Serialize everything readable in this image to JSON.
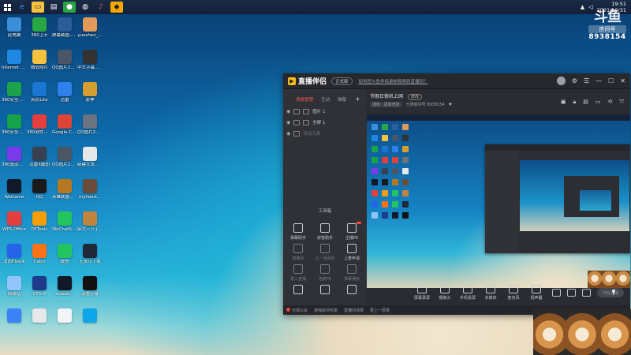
{
  "taskbar": {
    "clock_time": "19:51",
    "clock_date": "2021/10/31",
    "icons": [
      "start-icon",
      "edge-icon",
      "file-explorer-icon",
      "store-icon",
      "qq-icon",
      "app-icon",
      "douyin-icon",
      "obs-icon"
    ]
  },
  "watermark": {
    "logo": "斗鱼",
    "sub": "房间号",
    "room_id": "8938154"
  },
  "desktop_icons": [
    {
      "label": "此电脑",
      "color": "#3a8fd8"
    },
    {
      "label": "360卫士",
      "color": "#28a745"
    },
    {
      "label": "屏幕截图.png",
      "color": "#2b5d9a"
    },
    {
      "label": "yueshen_...",
      "color": "#e09a5a"
    },
    {
      "label": "Internet Explorer",
      "color": "#1e88e5"
    },
    {
      "label": "微软照片",
      "color": "#f6c23e"
    },
    {
      "label": "QQ图片2021072...",
      "color": "#4a5568"
    },
    {
      "label": "中文字幕.png",
      "color": "#333"
    },
    {
      "label": "360安全浏览器",
      "color": "#1aa34a"
    },
    {
      "label": "网页Lite",
      "color": "#1976d2"
    },
    {
      "label": "迅雷",
      "color": "#2f80ed"
    },
    {
      "label": "原神",
      "color": "#d69e2e"
    },
    {
      "label": "360安全卫士",
      "color": "#16a34a"
    },
    {
      "label": "360软件管家",
      "color": "#e53e3e"
    },
    {
      "label": "Google Chrome",
      "color": "#db4437"
    },
    {
      "label": "QQ图片2021072...",
      "color": "#6b7280"
    },
    {
      "label": "360驱动管家",
      "color": "#7c3aed"
    },
    {
      "label": "迅雷X截图",
      "color": "#374151"
    },
    {
      "label": "QQ图片2021072...",
      "color": "#4b5563"
    },
    {
      "label": "新建文本文档",
      "color": "#e5e7eb"
    },
    {
      "label": "WeGame",
      "color": "#111827"
    },
    {
      "label": "QQ",
      "color": "#1a1a1a"
    },
    {
      "label": "英雄联盟客户端",
      "color": "#b7791f"
    },
    {
      "label": "myheart...",
      "color": "#6b4c3b"
    },
    {
      "label": "WPS Office",
      "color": "#e53e3e"
    },
    {
      "label": "DYTools",
      "color": "#f59e0b"
    },
    {
      "label": "WeChatSe...",
      "color": "#22c55e"
    },
    {
      "label": "柴犬三只.jpg",
      "color": "#c0843d"
    },
    {
      "label": "消防Ebook",
      "color": "#2563eb"
    },
    {
      "label": "Catm",
      "color": "#f97316"
    },
    {
      "label": "微信",
      "color": "#22c55e"
    },
    {
      "label": "无水印下载",
      "color": "#1f2937"
    },
    {
      "label": "回收站",
      "color": "#93c5fd"
    },
    {
      "label": "CPU-Z",
      "color": "#1e3a8a"
    },
    {
      "label": "screen...",
      "color": "#111827"
    },
    {
      "label": "动态字幕",
      "color": "#111"
    },
    {
      "label": "",
      "color": "#3b82f6"
    },
    {
      "label": "",
      "color": "#e5e7eb"
    },
    {
      "label": "",
      "color": "#f3f4f6"
    },
    {
      "label": "",
      "color": "#0ea5e9"
    }
  ],
  "app": {
    "brand": "直播伴侣",
    "version_badge": "正式版",
    "notice": "如何把斗鱼伴侣录制视频到直播间？",
    "tabs": [
      "场景管理",
      "互动",
      "弹幕"
    ],
    "scenes": [
      {
        "label": "图片 1"
      },
      {
        "label": "全屏 1"
      },
      {
        "label": "添加元素"
      }
    ],
    "tools_title": "工具箱",
    "tools": [
      {
        "label": "弹幕助手",
        "dim": false,
        "new": false
      },
      {
        "label": "房管助手",
        "dim": false,
        "new": false
      },
      {
        "label": "主播PK",
        "dim": false,
        "new": true
      },
      {
        "label": "直播间",
        "dim": true,
        "new": false
      },
      {
        "label": "上一场回放",
        "dim": true,
        "new": false
      },
      {
        "label": "上麦申请",
        "dim": false,
        "new": false
      },
      {
        "label": "录入直播",
        "dim": true,
        "new": false
      },
      {
        "label": "连麦PK",
        "dim": true,
        "new": false
      },
      {
        "label": "弹幕播放",
        "dim": true,
        "new": false
      },
      {
        "label": "",
        "dim": false,
        "new": false
      },
      {
        "label": "",
        "dim": false,
        "new": false
      },
      {
        "label": "",
        "dim": false,
        "new": false
      }
    ],
    "room_title": "节假日修机上网",
    "room_tag": "修改",
    "room_category": "游戏 · 星际竞技",
    "room_id_text": "分类房间号 8938154",
    "bottom_tools": [
      "屏幕录屏",
      "摄像头",
      "手机投屏",
      "多媒体",
      "麦克风",
      "扬声器"
    ],
    "go_live": "开始直播",
    "status": [
      "无线公会",
      "游戏房间可能",
      "直播间违规",
      "更上一层楼"
    ]
  }
}
